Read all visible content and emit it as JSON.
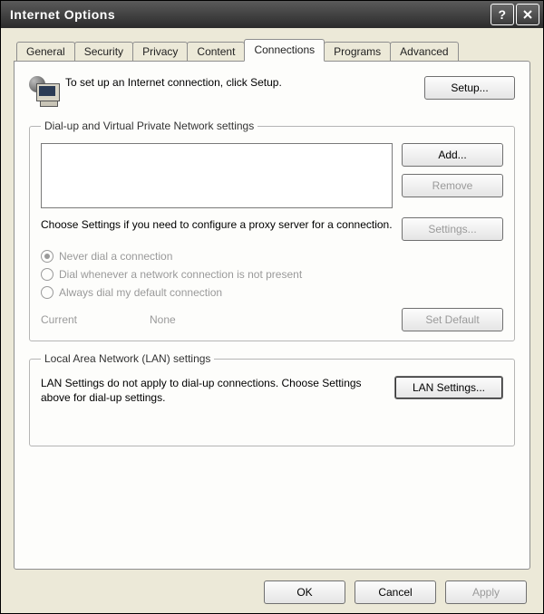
{
  "window": {
    "title": "Internet Options"
  },
  "tabs": {
    "general": "General",
    "security": "Security",
    "privacy": "Privacy",
    "content": "Content",
    "connections": "Connections",
    "programs": "Programs",
    "advanced": "Advanced",
    "active": "connections"
  },
  "intro": {
    "text": "To set up an Internet connection, click Setup.",
    "setup_btn": "Setup..."
  },
  "dialup": {
    "legend": "Dial-up and Virtual Private Network settings",
    "add_btn": "Add...",
    "remove_btn": "Remove",
    "settings_btn": "Settings...",
    "desc": "Choose Settings if you need to configure a proxy server for a connection.",
    "radio_never": "Never dial a connection",
    "radio_whenever": "Dial whenever a network connection is not present",
    "radio_always": "Always dial my default connection",
    "selected_radio": "never",
    "current_label": "Current",
    "current_value": "None",
    "setdefault_btn": "Set Default"
  },
  "lan": {
    "legend": "Local Area Network (LAN) settings",
    "desc": "LAN Settings do not apply to dial-up connections. Choose Settings above for dial-up settings.",
    "btn": "LAN Settings..."
  },
  "buttons": {
    "ok": "OK",
    "cancel": "Cancel",
    "apply": "Apply"
  }
}
